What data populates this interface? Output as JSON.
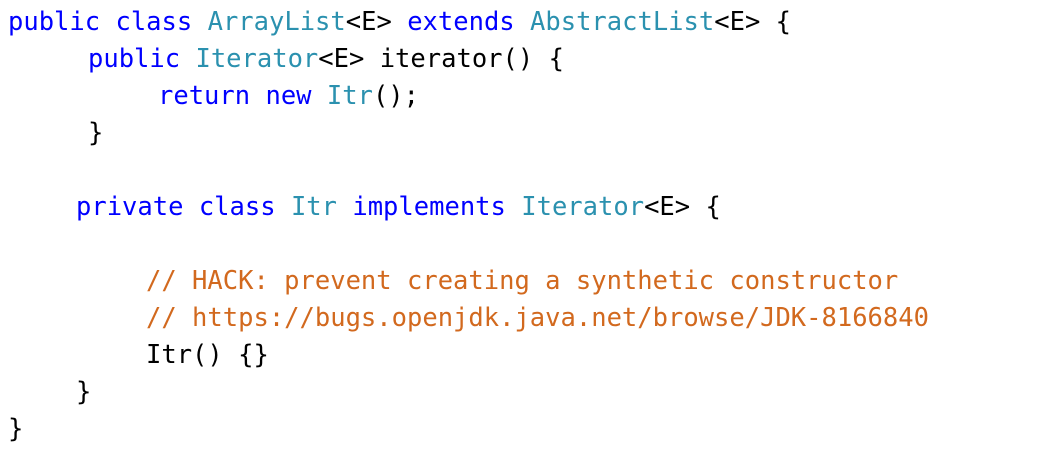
{
  "colors": {
    "keyword": "#0000ff",
    "type": "#2b91af",
    "comment": "#d2691e",
    "text": "#000000",
    "background": "#ffffff"
  },
  "code": {
    "line1": {
      "kw1": "public class ",
      "type1": "ArrayList",
      "t1": "<E> ",
      "kw2": "extends ",
      "type2": "AbstractList",
      "t2": "<E> {"
    },
    "line2": {
      "kw1": "public ",
      "type1": "Iterator",
      "t1": "<E> iterator() {"
    },
    "line3": {
      "kw1": "return new ",
      "type1": "Itr",
      "t1": "();"
    },
    "line4": {
      "t1": "}"
    },
    "line6": {
      "kw1": "private class ",
      "type1": "Itr",
      "kw2": " implements ",
      "type2": "Iterator",
      "t1": "<E> {"
    },
    "line8": {
      "comment": "// HACK: prevent creating a synthetic constructor"
    },
    "line9": {
      "comment": "// https://bugs.openjdk.java.net/browse/JDK-8166840"
    },
    "line10": {
      "t1": "Itr() {}"
    },
    "line11": {
      "t1": "}"
    },
    "line12": {
      "t1": "}"
    }
  }
}
